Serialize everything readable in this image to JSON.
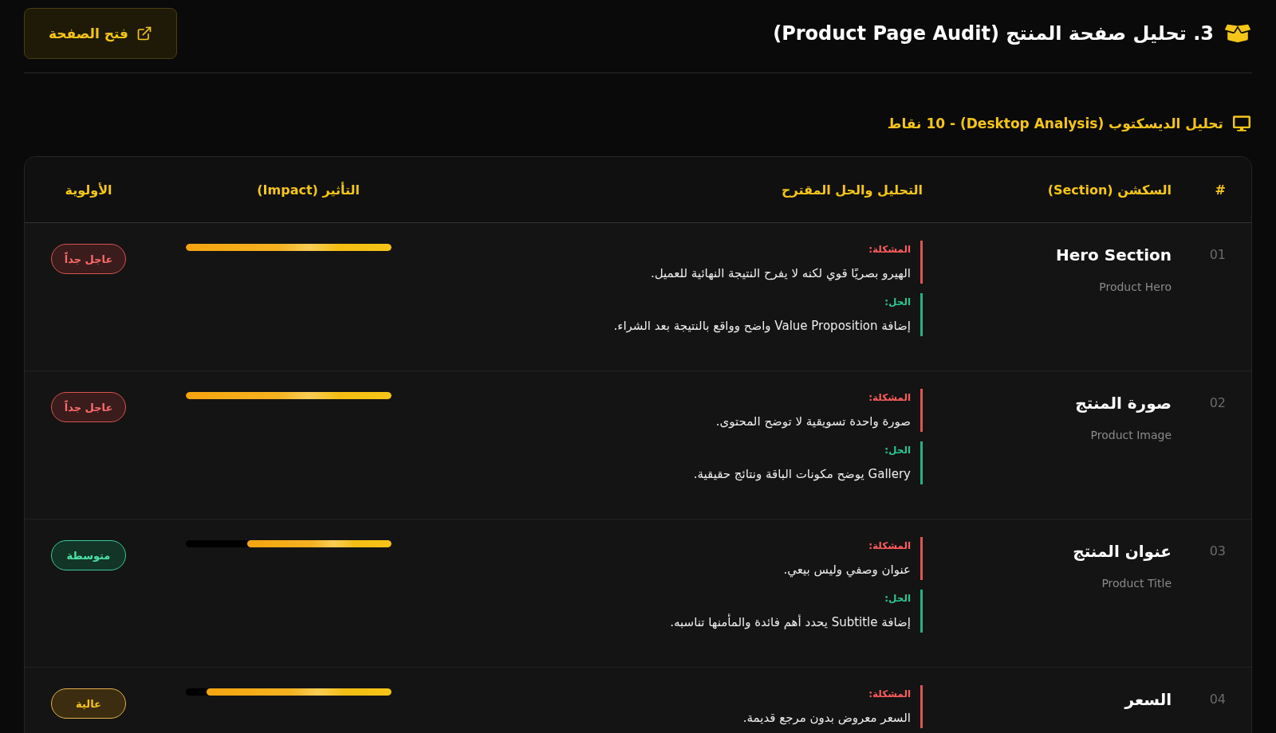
{
  "header": {
    "title": "3. تحليل صفحة المنتج (Product Page Audit)",
    "open_button": "فتح الصفحة"
  },
  "section_heading": "تحليل الديسكتوب (Desktop Analysis) - 10 نقاط",
  "table": {
    "columns": [
      "#",
      "السكشن (Section)",
      "التحليل والحل المقترح",
      "التأثير (Impact)",
      "الأولوية"
    ],
    "rows": [
      {
        "number": "01",
        "title": "Hero Section",
        "subtitle": "Product Hero",
        "problem_label": "المشكلة:",
        "problem": "الهيرو بصريًا قوي لكنه لا يفرح النتيجة النهائية للعميل.",
        "solution_label": "الحل:",
        "solution": "إضافة Value Proposition واضح وواقع بالنتيجة بعد الشراء.",
        "impact": {
          "level": 1
        },
        "priority": {
          "label": "عاجل جداً",
          "kind": "urgent"
        }
      },
      {
        "number": "02",
        "title": "صورة المنتج",
        "subtitle": "Product Image",
        "problem_label": "المشكلة:",
        "problem": "صورة واحدة تسويقية لا توضح المحتوى.",
        "solution_label": "الحل:",
        "solution": "Gallery يوضح مكونات الباقة ونتائج حقيقية.",
        "impact": {
          "level": 1
        },
        "priority": {
          "label": "عاجل جداً",
          "kind": "urgent"
        }
      },
      {
        "number": "03",
        "title": "عنوان المنتج",
        "subtitle": "Product Title",
        "problem_label": "المشكلة:",
        "problem": "عنوان وصفي وليس بيعي.",
        "solution_label": "الحل:",
        "solution": "إضافة Subtitle يحدد أهم فائدة والمأمنها تناسبه.",
        "impact": {
          "level": 0.7
        },
        "priority": {
          "label": "متوسطة",
          "kind": "medium"
        }
      },
      {
        "number": "04",
        "title": "السعر",
        "problem_label": "المشكلة:",
        "problem": "السعر معروض بدون مرجع قديمة.",
        "impact": {
          "level": 0.9
        },
        "priority": {
          "label": "عالية",
          "kind": "high"
        }
      }
    ]
  }
}
